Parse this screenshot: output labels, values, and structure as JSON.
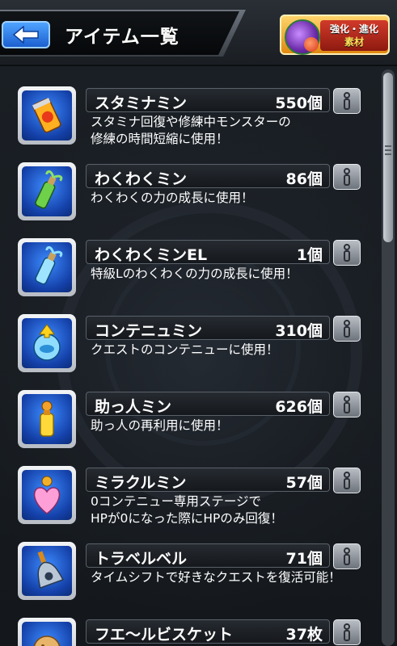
{
  "header": {
    "title": "アイテム一覧",
    "evolution_button": {
      "line1": "強化・進化",
      "line2": "素材"
    }
  },
  "items": [
    {
      "name": "スタミナミン",
      "count": "550個",
      "description": "スタミナ回復や修練中モンスターの\n修練の時間短縮に使用！",
      "icon": "stamina-can-icon"
    },
    {
      "name": "わくわくミン",
      "count": "86個",
      "description": "わくわくの力の成長に使用！",
      "icon": "green-bottle-icon"
    },
    {
      "name": "わくわくミンEL",
      "count": "1個",
      "description": "特級Lのわくわくの力の成長に使用！",
      "icon": "blue-bottle-icon"
    },
    {
      "name": "コンテニュミン",
      "count": "310個",
      "description": "クエストのコンテニューに使用！",
      "icon": "continue-orb-icon"
    },
    {
      "name": "助っ人ミン",
      "count": "626個",
      "description": "助っ人の再利用に使用！",
      "icon": "yellow-vial-icon"
    },
    {
      "name": "ミラクルミン",
      "count": "57個",
      "description": "0コンテニュー専用ステージで\nHPが0になった際にHPのみ回復！",
      "icon": "pink-heart-icon"
    },
    {
      "name": "トラベルベル",
      "count": "71個",
      "description": "タイムシフトで好きなクエストを復活可能！",
      "icon": "bell-icon"
    },
    {
      "name": "フエ～ルビスケット",
      "count": "37枚",
      "description": "",
      "icon": "biscuit-icon"
    }
  ]
}
